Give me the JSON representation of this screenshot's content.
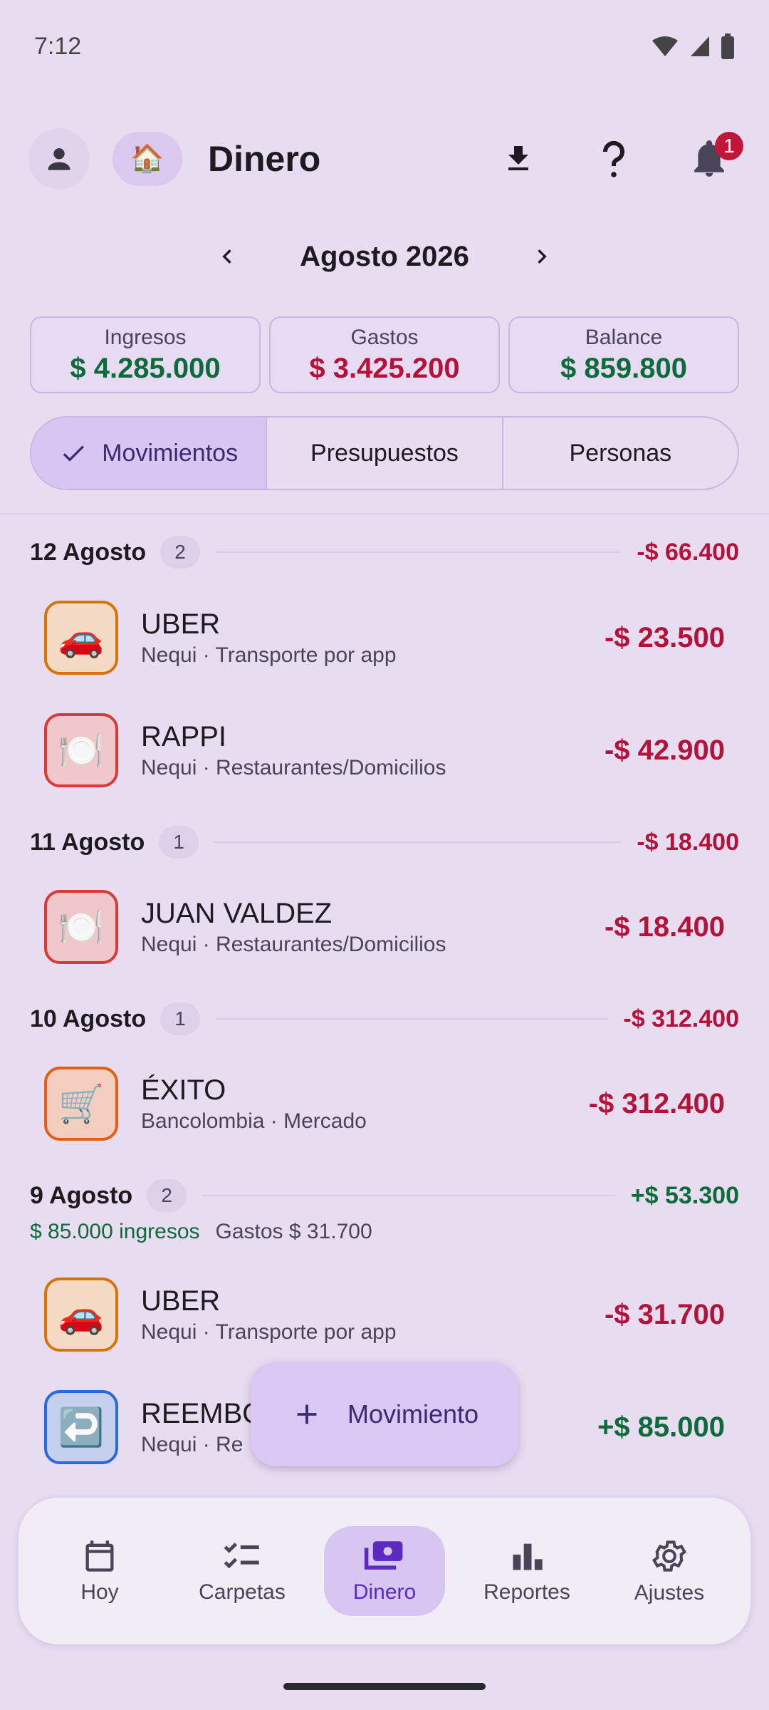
{
  "status": {
    "time": "7:12"
  },
  "header": {
    "title": "Dinero",
    "home_emoji": "🏠",
    "notification_count": "1"
  },
  "month_nav": {
    "label": "Agosto 2026"
  },
  "summary": {
    "income": {
      "label": "Ingresos",
      "value": "$ 4.285.000"
    },
    "expenses": {
      "label": "Gastos",
      "value": "$ 3.425.200"
    },
    "balance": {
      "label": "Balance",
      "value": "$ 859.800"
    }
  },
  "tabs": [
    {
      "label": "Movimientos",
      "active": true
    },
    {
      "label": "Presupuestos",
      "active": false
    },
    {
      "label": "Personas",
      "active": false
    }
  ],
  "days": [
    {
      "title": "12 Agosto",
      "count": "2",
      "total": "-$ 66.400"
    },
    {
      "title": "11 Agosto",
      "count": "1",
      "total": "-$ 18.400"
    },
    {
      "title": "10 Agosto",
      "count": "1",
      "total": "-$ 312.400"
    },
    {
      "title": "9 Agosto",
      "count": "2",
      "total": "+$ 53.300",
      "income_text": "$ 85.000 ingresos",
      "expense_text": "Gastos $ 31.700"
    }
  ],
  "transactions": [
    {
      "emoji": "🚗",
      "name": "UBER",
      "sub": "Nequi · Transporte por app",
      "amount": "-$ 23.500"
    },
    {
      "emoji": "🍽️",
      "name": "RAPPI",
      "sub": "Nequi · Restaurantes/Domicilios",
      "amount": "-$ 42.900"
    },
    {
      "emoji": "🍽️",
      "name": "JUAN VALDEZ",
      "sub": "Nequi · Restaurantes/Domicilios",
      "amount": "-$ 18.400"
    },
    {
      "emoji": "🛒",
      "name": "ÉXITO",
      "sub": "Bancolombia · Mercado",
      "amount": "-$ 312.400"
    },
    {
      "emoji": "🚗",
      "name": "UBER",
      "sub": "Nequi · Transporte por app",
      "amount": "-$ 31.700"
    },
    {
      "emoji": "↩️",
      "name": "REEMBOLSO",
      "sub": "Nequi · Re",
      "amount": "+$ 85.000"
    }
  ],
  "fab": {
    "label": "Movimiento"
  },
  "bottom_nav": [
    {
      "label": "Hoy",
      "icon": "calendar-icon"
    },
    {
      "label": "Carpetas",
      "icon": "checklist-icon"
    },
    {
      "label": "Dinero",
      "icon": "money-icon",
      "active": true
    },
    {
      "label": "Reportes",
      "icon": "bar-chart-icon"
    },
    {
      "label": "Ajustes",
      "icon": "gear-icon"
    }
  ],
  "colors": {
    "background": "#e8dcf1",
    "accent": "#5b2bbf",
    "income": "#0d6b3a",
    "expense": "#b3123a",
    "badge": "#c0163a"
  }
}
